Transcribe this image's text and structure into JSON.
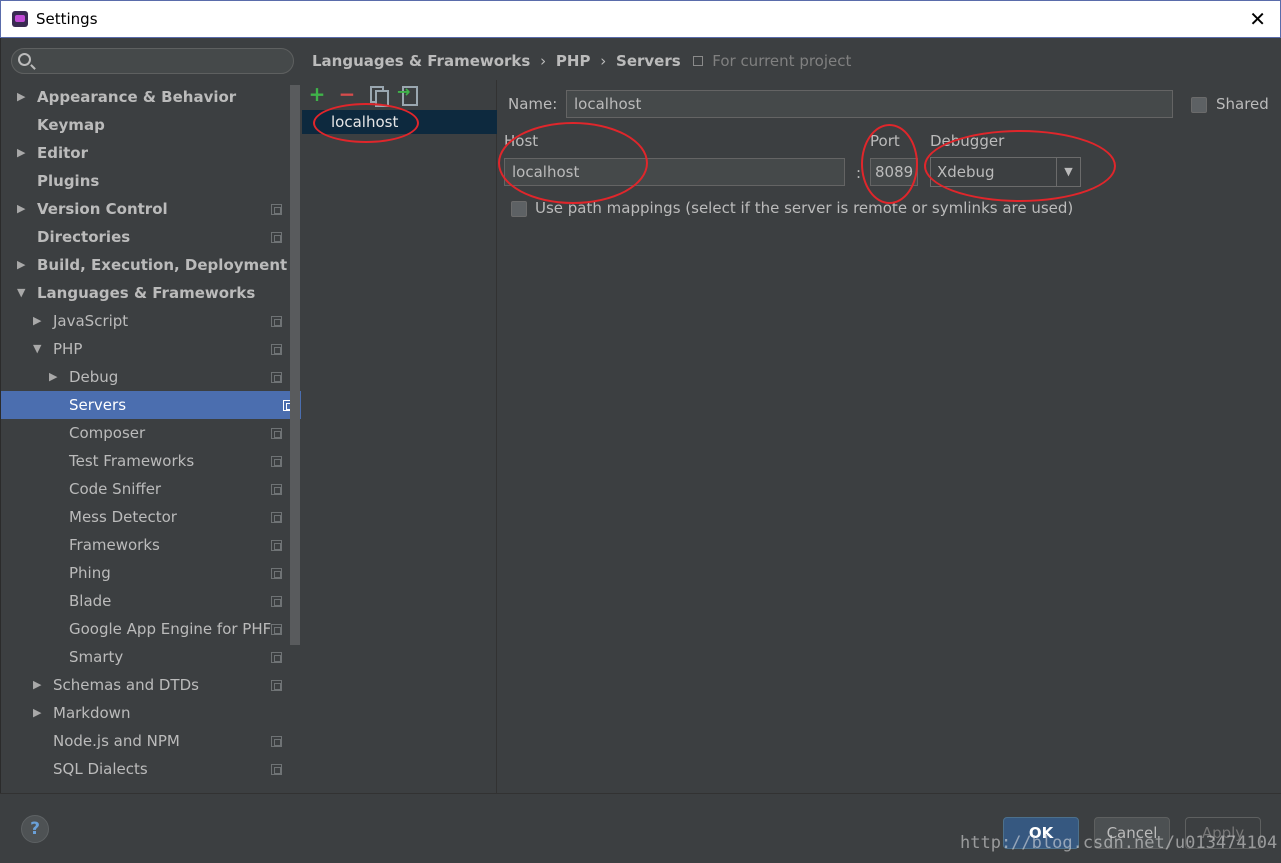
{
  "window": {
    "title": "Settings",
    "close_glyph": "✕"
  },
  "sidebar": {
    "items": [
      {
        "label": "Appearance & Behavior",
        "arrow": "▶",
        "bold": true
      },
      {
        "label": "Keymap",
        "arrow": "",
        "bold": true
      },
      {
        "label": "Editor",
        "arrow": "▶",
        "bold": true
      },
      {
        "label": "Plugins",
        "arrow": "",
        "bold": true
      },
      {
        "label": "Version Control",
        "arrow": "▶",
        "bold": true
      },
      {
        "label": "Directories",
        "arrow": "",
        "bold": true
      },
      {
        "label": "Build, Execution, Deployment",
        "arrow": "▶",
        "bold": true
      },
      {
        "label": "Languages & Frameworks",
        "arrow": "▼",
        "bold": true
      },
      {
        "label": "JavaScript",
        "arrow": "▶"
      },
      {
        "label": "PHP",
        "arrow": "▼"
      },
      {
        "label": "Debug",
        "arrow": "▶"
      },
      {
        "label": "Servers",
        "arrow": "",
        "selected": true
      },
      {
        "label": "Composer",
        "arrow": ""
      },
      {
        "label": "Test Frameworks",
        "arrow": ""
      },
      {
        "label": "Code Sniffer",
        "arrow": ""
      },
      {
        "label": "Mess Detector",
        "arrow": ""
      },
      {
        "label": "Frameworks",
        "arrow": ""
      },
      {
        "label": "Phing",
        "arrow": ""
      },
      {
        "label": "Blade",
        "arrow": ""
      },
      {
        "label": "Google App Engine for PHF",
        "arrow": ""
      },
      {
        "label": "Smarty",
        "arrow": ""
      },
      {
        "label": "Schemas and DTDs",
        "arrow": "▶"
      },
      {
        "label": "Markdown",
        "arrow": "▶"
      },
      {
        "label": "Node.js and NPM",
        "arrow": ""
      },
      {
        "label": "SQL Dialects",
        "arrow": ""
      }
    ]
  },
  "breadcrumb": {
    "part1": "Languages & Frameworks",
    "sep": "›",
    "part2": "PHP",
    "part3": "Servers",
    "hint": "For current project"
  },
  "servers": {
    "toolbar": {
      "add": "+",
      "remove": "−"
    },
    "list": [
      "localhost"
    ]
  },
  "form": {
    "name_label": "Name:",
    "name_value": "localhost",
    "shared_label": "Shared",
    "host_label": "Host",
    "host_value": "localhost",
    "colon": ":",
    "port_label": "Port",
    "port_value": "8089",
    "debugger_label": "Debugger",
    "debugger_value": "Xdebug",
    "dropdown_arrow": "▼",
    "path_mappings_label": "Use path mappings (select if the server is remote or symlinks are used)"
  },
  "footer": {
    "help": "?",
    "ok": "OK",
    "cancel": "Cancel",
    "apply": "Apply",
    "watermark": "http://blog.csdn.net/u013474104"
  },
  "colors": {
    "background": "#3c3f41",
    "selection": "#4b6eaf",
    "annotation": "#e0262b",
    "add_green": "#3fb349",
    "remove_red": "#d64c4c"
  }
}
